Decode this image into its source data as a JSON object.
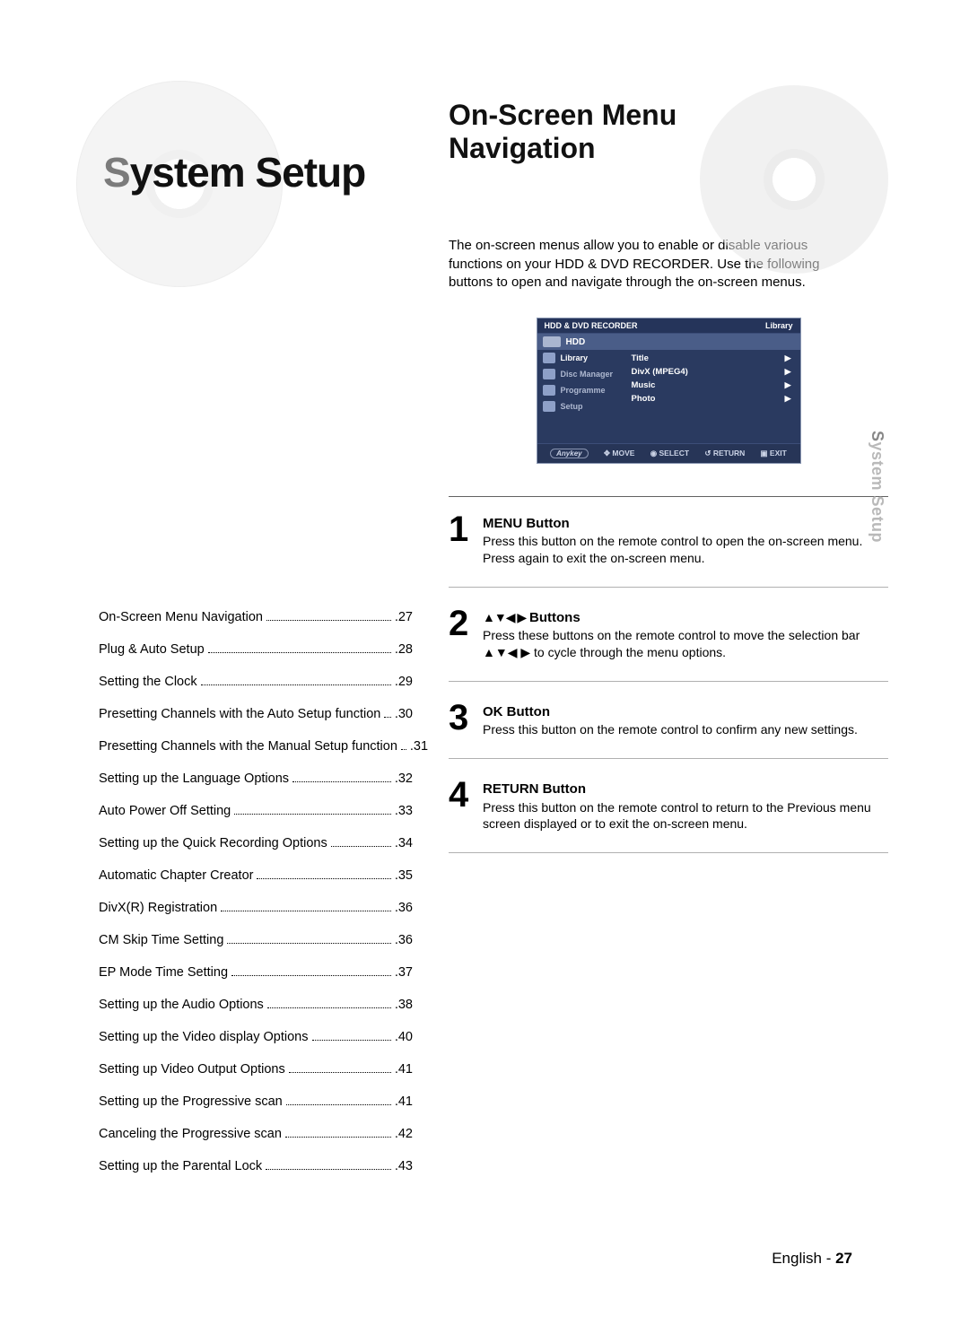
{
  "chapter": {
    "initial": "S",
    "rest": "ystem Setup"
  },
  "toc": [
    {
      "label": "On-Screen Menu Navigation",
      "page": "27"
    },
    {
      "label": "Plug & Auto Setup",
      "page": "28"
    },
    {
      "label": "Setting the Clock",
      "page": "29"
    },
    {
      "label": "Presetting Channels with the Auto Setup function",
      "page": "30"
    },
    {
      "label": "Presetting Channels with the Manual Setup function",
      "page": "31"
    },
    {
      "label": "Setting up the Language Options",
      "page": "32"
    },
    {
      "label": "Auto Power Off Setting",
      "page": "33"
    },
    {
      "label": "Setting up the Quick Recording Options",
      "page": "34"
    },
    {
      "label": "Automatic Chapter Creator",
      "page": "35"
    },
    {
      "label": "DivX(R) Registration",
      "page": "36"
    },
    {
      "label": "CM Skip Time Setting",
      "page": "36"
    },
    {
      "label": "EP Mode Time Setting",
      "page": "37"
    },
    {
      "label": "Setting up the Audio Options",
      "page": "38"
    },
    {
      "label": "Setting up the Video display Options",
      "page": "40"
    },
    {
      "label": "Setting up Video Output Options",
      "page": "41"
    },
    {
      "label": "Setting up the Progressive scan",
      "page": "41"
    },
    {
      "label": "Canceling the Progressive scan",
      "page": "42"
    },
    {
      "label": "Setting up the Parental Lock",
      "page": "43"
    }
  ],
  "section": {
    "title_line1": "On-Screen Menu",
    "title_line2": "Navigation",
    "intro": "The on-screen menus allow you to enable or disable various functions on your HDD & DVD RECORDER. Use the following buttons to open and navigate through the on-screen menus."
  },
  "osd": {
    "header_left": "HDD & DVD RECORDER",
    "header_right": "Library",
    "device": "HDD",
    "side": [
      "Library",
      "Disc Manager",
      "Programme",
      "Setup"
    ],
    "main": [
      "Title",
      "DivX (MPEG4)",
      "Music",
      "Photo"
    ],
    "foot_key": "Anykey",
    "foot": [
      "MOVE",
      "SELECT",
      "RETURN",
      "EXIT"
    ],
    "foot_icons": [
      "✥",
      "◉",
      "↺",
      "▣"
    ]
  },
  "steps": [
    {
      "num": "1",
      "title": "MENU Button",
      "body": "Press this button on the remote control to open the on-screen menu.\nPress again to exit the on-screen menu."
    },
    {
      "num": "2",
      "title_prefix_arrows": "▲▼◀ ▶",
      "title": "Buttons",
      "body": "Press these buttons on the remote control to move the selection bar ▲▼◀ ▶ to cycle through the menu options."
    },
    {
      "num": "3",
      "title": "OK Button",
      "body": "Press this button on the remote control to confirm any new settings."
    },
    {
      "num": "4",
      "title": "RETURN Button",
      "body": "Press this button on the remote control to return to the Previous menu screen displayed or to exit the on-screen menu."
    }
  ],
  "sidetab": {
    "initial": "S",
    "rest": "ystem Setup"
  },
  "footer": {
    "lang": "English",
    "sep": " - ",
    "page": "27"
  }
}
